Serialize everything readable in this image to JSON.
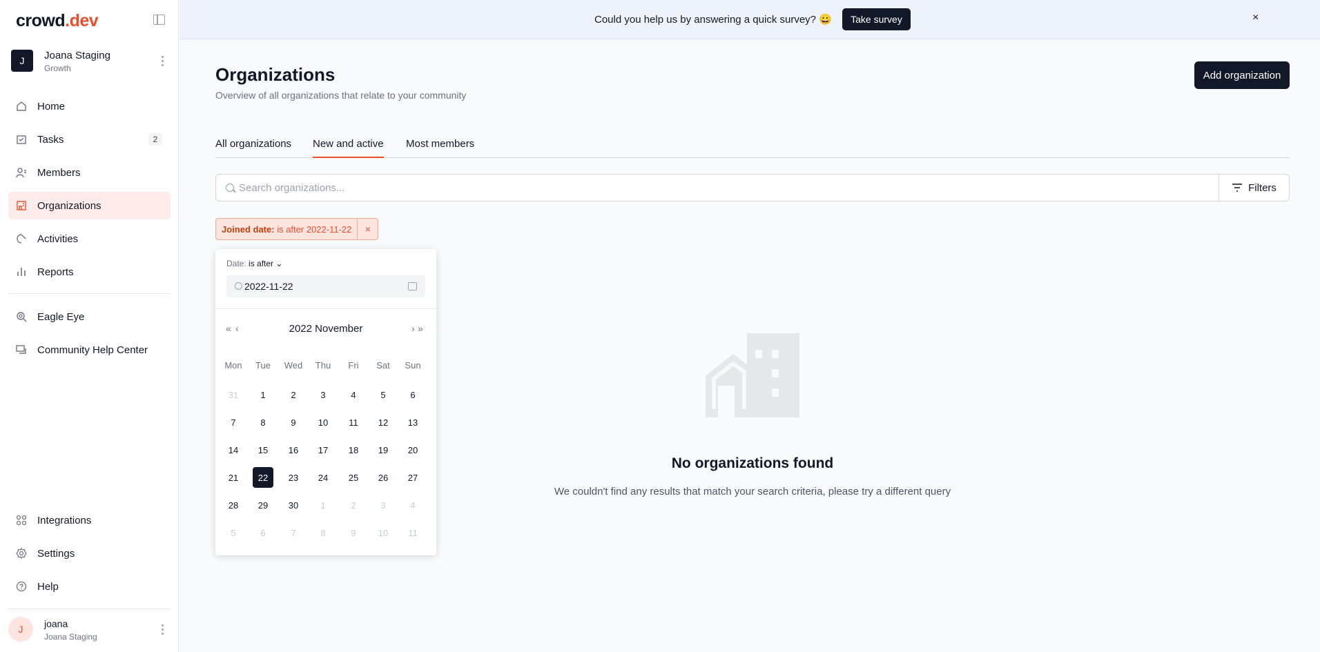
{
  "app": {
    "logo_main": "crowd",
    "logo_accent": ".dev"
  },
  "workspace": {
    "initial": "J",
    "name": "Joana Staging",
    "plan": "Growth"
  },
  "sidebar": {
    "items": [
      {
        "label": "Home",
        "icon": "home-icon"
      },
      {
        "label": "Tasks",
        "icon": "tasks-icon",
        "badge": "2"
      },
      {
        "label": "Members",
        "icon": "members-icon"
      },
      {
        "label": "Organizations",
        "icon": "organizations-icon",
        "active": true
      },
      {
        "label": "Activities",
        "icon": "activities-icon"
      },
      {
        "label": "Reports",
        "icon": "reports-icon"
      },
      {
        "label": "Eagle Eye",
        "icon": "eagle-eye-icon"
      },
      {
        "label": "Community Help Center",
        "icon": "help-center-icon"
      }
    ],
    "bottom_items": [
      {
        "label": "Integrations",
        "icon": "integrations-icon"
      },
      {
        "label": "Settings",
        "icon": "gear-icon"
      },
      {
        "label": "Help",
        "icon": "help-icon"
      }
    ]
  },
  "user": {
    "initial": "J",
    "name": "joana",
    "workspace": "Joana Staging"
  },
  "banner": {
    "text": "Could you help us by answering a quick survey? 😀",
    "button": "Take survey",
    "close": "×"
  },
  "page": {
    "title": "Organizations",
    "subtitle": "Overview of all organizations that relate to your community",
    "add_button": "Add organization"
  },
  "tabs": [
    {
      "label": "All organizations",
      "active": false
    },
    {
      "label": "New and active",
      "active": true
    },
    {
      "label": "Most members",
      "active": false
    }
  ],
  "search": {
    "placeholder": "Search organizations...",
    "value": ""
  },
  "filters": {
    "button": "Filters",
    "chip_label": "Joined date:",
    "chip_value": "is after 2022-11-22",
    "chip_close": "×"
  },
  "date_filter": {
    "label": "Date:",
    "operator": "is after",
    "value": "2022-11-22",
    "calendar_title": "2022 November",
    "weekdays": [
      "Mon",
      "Tue",
      "Wed",
      "Thu",
      "Fri",
      "Sat",
      "Sun"
    ],
    "weeks": [
      [
        {
          "d": "31",
          "m": true
        },
        {
          "d": "1"
        },
        {
          "d": "2"
        },
        {
          "d": "3"
        },
        {
          "d": "4"
        },
        {
          "d": "5"
        },
        {
          "d": "6"
        }
      ],
      [
        {
          "d": "7"
        },
        {
          "d": "8"
        },
        {
          "d": "9"
        },
        {
          "d": "10"
        },
        {
          "d": "11"
        },
        {
          "d": "12"
        },
        {
          "d": "13"
        }
      ],
      [
        {
          "d": "14"
        },
        {
          "d": "15"
        },
        {
          "d": "16"
        },
        {
          "d": "17"
        },
        {
          "d": "18"
        },
        {
          "d": "19"
        },
        {
          "d": "20"
        }
      ],
      [
        {
          "d": "21"
        },
        {
          "d": "22",
          "s": true
        },
        {
          "d": "23"
        },
        {
          "d": "24"
        },
        {
          "d": "25"
        },
        {
          "d": "26"
        },
        {
          "d": "27"
        }
      ],
      [
        {
          "d": "28"
        },
        {
          "d": "29"
        },
        {
          "d": "30"
        },
        {
          "d": "1",
          "m": true
        },
        {
          "d": "2",
          "m": true
        },
        {
          "d": "3",
          "m": true
        },
        {
          "d": "4",
          "m": true
        }
      ],
      [
        {
          "d": "5",
          "m": true
        },
        {
          "d": "6",
          "m": true
        },
        {
          "d": "7",
          "m": true
        },
        {
          "d": "8",
          "m": true
        },
        {
          "d": "9",
          "m": true
        },
        {
          "d": "10",
          "m": true
        },
        {
          "d": "11",
          "m": true
        }
      ]
    ]
  },
  "empty_state": {
    "title": "No organizations found",
    "subtitle": "We couldn't find any results that match your search criteria, please try a different query"
  },
  "colors": {
    "accent": "#e94f2e",
    "dark": "#111827",
    "active_bg": "#fdecea"
  }
}
